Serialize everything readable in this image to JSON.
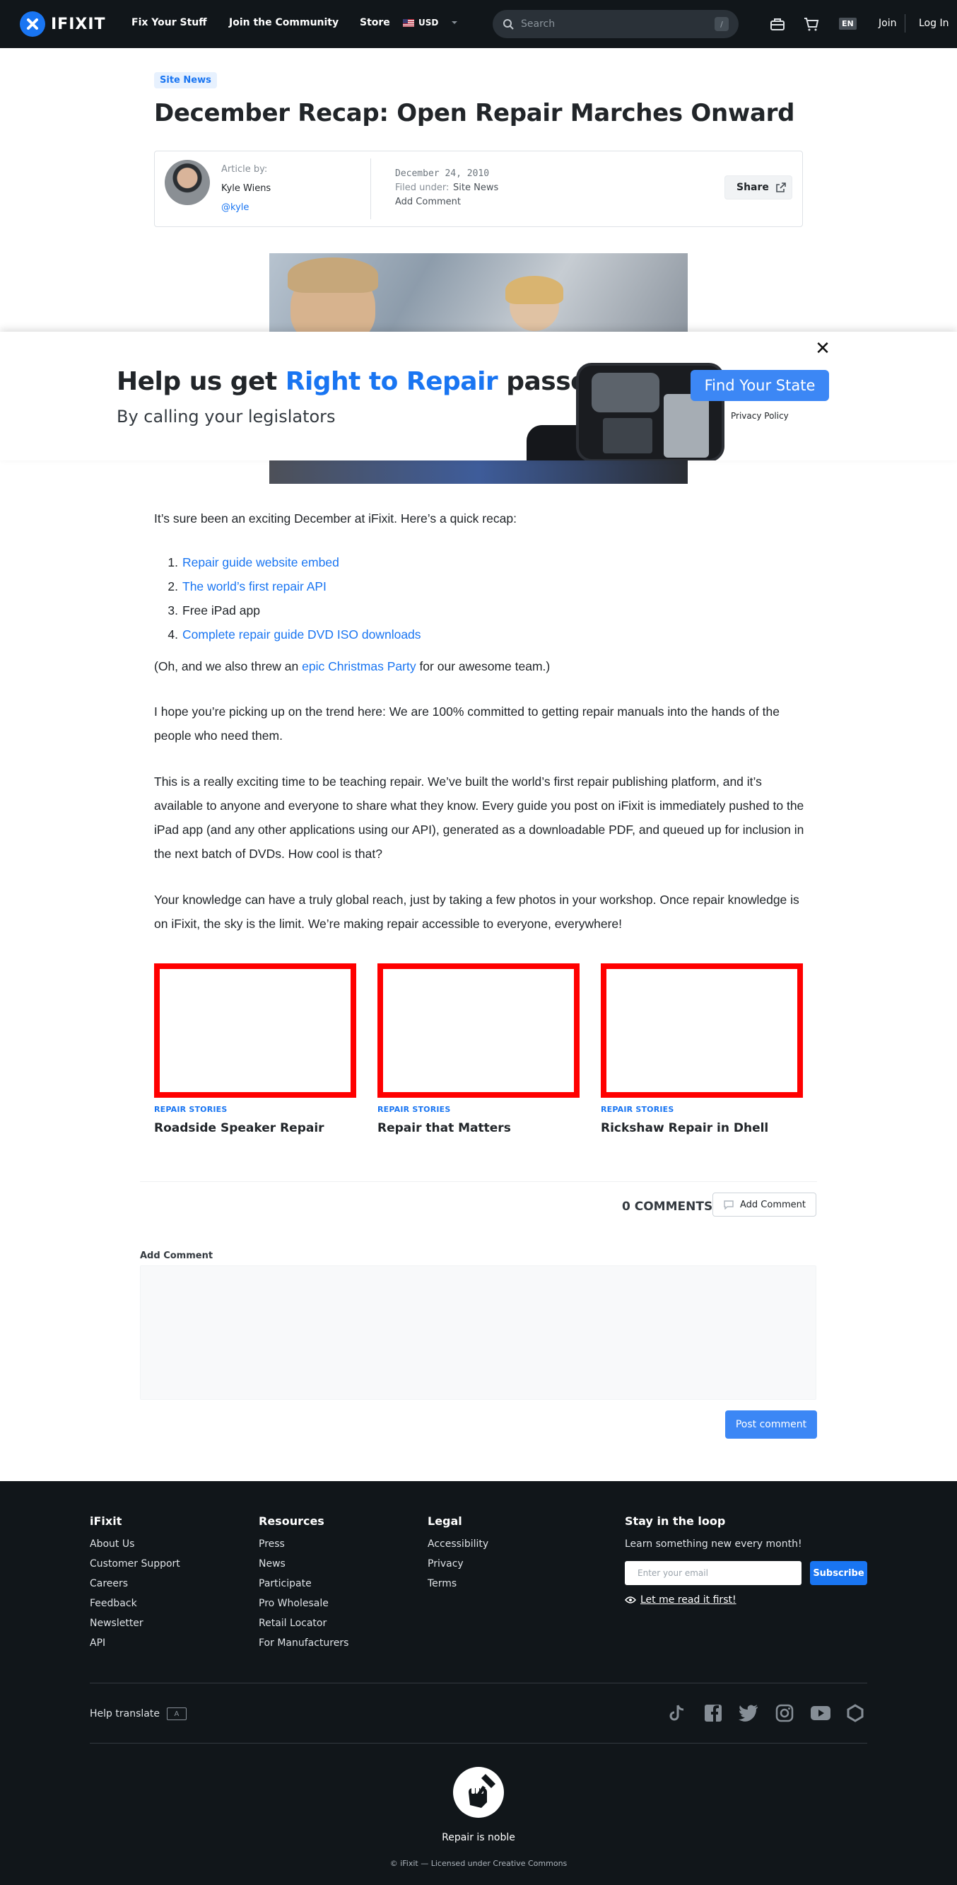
{
  "nav": {
    "brand": "IFIXIT",
    "links": [
      "Fix Your Stuff",
      "Join the Community",
      "Store"
    ],
    "currency": "USD",
    "search_placeholder": "Search",
    "search_shortcut": "/",
    "language": "EN",
    "join": "Join",
    "login": "Log In"
  },
  "article": {
    "category": "Site News",
    "title": "December Recap: Open Repair Marches Onward",
    "author_label": "Article by:",
    "author_name": "Kyle Wiens",
    "author_handle": "@kyle",
    "date": "December 24, 2010",
    "filed_label": "Filed under:",
    "filed_value": "Site News",
    "add_comment": "Add Comment",
    "share": "Share"
  },
  "banner": {
    "title_start": "Help us get ",
    "title_highlight": "Right to Repair",
    "title_end": " passed",
    "subtitle": "By calling your legislators",
    "cta": "Find Your State",
    "privacy": "Privacy Policy",
    "close": "✕"
  },
  "body": {
    "intro": "It’s sure been an exciting December at iFixit. Here’s a quick recap:",
    "list": [
      {
        "num": "1.",
        "text": "Repair guide website embed"
      },
      {
        "num": "2.",
        "text": "The world’s first repair API"
      },
      {
        "num": "3.",
        "text": "Free iPad app"
      },
      {
        "num": "4.",
        "text": "Complete repair guide DVD ISO downloads"
      }
    ],
    "party_pre": "(Oh, and we also threw an ",
    "party_link": "epic Christmas Party",
    "party_post": " for our awesome team.)",
    "p2": "I hope you’re picking up on the trend here: We are 100% committed to getting repair manuals into the hands of the people who need them.",
    "p3": "This is a really exciting time to be teaching repair. We’ve built the world’s first repair publishing platform, and it’s available to anyone and everyone to share what they know. Every guide you post on iFixit is immediately pushed to the iPad app (and any other applications using our API), generated as a downloadable PDF, and queued up for inclusion in the next batch of DVDs. How cool is that?",
    "p4": "Your knowledge can have a truly global reach, just by taking a few photos in your workshop. Once repair knowledge is on iFixit, the sky is the limit. We’re making repair accessible to everyone, everywhere!"
  },
  "related": [
    {
      "category": "REPAIR STORIES",
      "title": "Roadside Speaker Repair"
    },
    {
      "category": "REPAIR STORIES",
      "title": "Repair that Matters"
    },
    {
      "category": "REPAIR STORIES",
      "title": "Rickshaw Repair in Dhell"
    }
  ],
  "comments": {
    "count": "0 COMMENTS",
    "add_button": "Add Comment",
    "form_label": "Add Comment",
    "post_button": "Post comment"
  },
  "footer": {
    "col1": {
      "heading": "iFixit",
      "links": [
        "About Us",
        "Customer Support",
        "Careers",
        "Feedback",
        "Newsletter",
        "API"
      ]
    },
    "col2": {
      "heading": "Resources",
      "links": [
        "Press",
        "News",
        "Participate",
        "Pro Wholesale",
        "Retail Locator",
        "For Manufacturers"
      ]
    },
    "col3": {
      "heading": "Legal",
      "links": [
        "Accessibility",
        "Privacy",
        "Terms"
      ]
    },
    "newsletter": {
      "heading": "Stay in the loop",
      "sub": "Learn something new every month!",
      "email_placeholder": "Enter your email",
      "subscribe": "Subscribe",
      "read_first": "Let me read it first!"
    },
    "translate": "Help translate",
    "socials": [
      "tiktok-icon",
      "facebook-icon",
      "twitter-icon",
      "instagram-icon",
      "youtube-icon",
      "repair-org-icon"
    ],
    "tagline": "Repair is noble",
    "copyright": "© iFixit — Licensed under Creative Commons"
  }
}
